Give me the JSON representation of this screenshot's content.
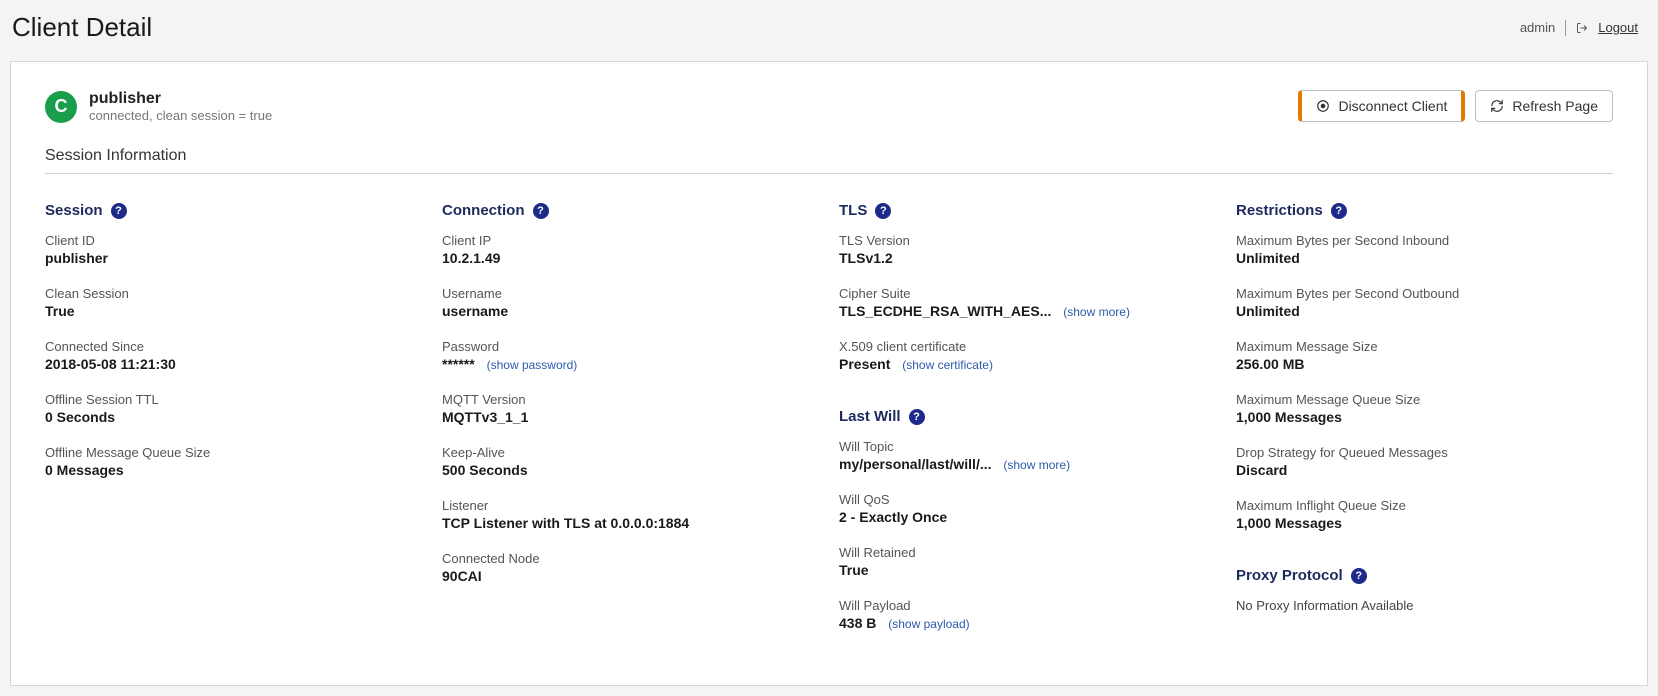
{
  "header": {
    "title": "Client Detail",
    "user": "admin",
    "logout": "Logout"
  },
  "client": {
    "avatar_letter": "C",
    "name": "publisher",
    "status_line": "connected, clean session = true"
  },
  "buttons": {
    "disconnect": "Disconnect Client",
    "refresh": "Refresh Page"
  },
  "section_title": "Session Information",
  "groups": {
    "session": {
      "title": "Session",
      "client_id": {
        "label": "Client ID",
        "value": "publisher"
      },
      "clean_session": {
        "label": "Clean Session",
        "value": "True"
      },
      "connected_since": {
        "label": "Connected Since",
        "value": "2018-05-08 11:21:30"
      },
      "offline_ttl": {
        "label": "Offline Session TTL",
        "value": "0 Seconds"
      },
      "offline_queue": {
        "label": "Offline Message Queue Size",
        "value": "0 Messages"
      }
    },
    "connection": {
      "title": "Connection",
      "client_ip": {
        "label": "Client IP",
        "value": "10.2.1.49"
      },
      "username": {
        "label": "Username",
        "value": "username"
      },
      "password": {
        "label": "Password",
        "value": "******",
        "link": "(show password)"
      },
      "mqtt_version": {
        "label": "MQTT Version",
        "value": "MQTTv3_1_1"
      },
      "keep_alive": {
        "label": "Keep-Alive",
        "value": "500 Seconds"
      },
      "listener": {
        "label": "Listener",
        "value": "TCP Listener with TLS at 0.0.0.0:1884"
      },
      "connected_node": {
        "label": "Connected Node",
        "value": "90CAI"
      }
    },
    "tls": {
      "title": "TLS",
      "version": {
        "label": "TLS Version",
        "value": "TLSv1.2"
      },
      "cipher": {
        "label": "Cipher Suite",
        "value": "TLS_ECDHE_RSA_WITH_AES...",
        "link": "(show more)"
      },
      "cert": {
        "label": "X.509 client certificate",
        "value": "Present",
        "link": "(show certificate)"
      }
    },
    "last_will": {
      "title": "Last Will",
      "topic": {
        "label": "Will Topic",
        "value": "my/personal/last/will/...",
        "link": "(show more)"
      },
      "qos": {
        "label": "Will QoS",
        "value": "2 - Exactly Once"
      },
      "retained": {
        "label": "Will Retained",
        "value": "True"
      },
      "payload": {
        "label": "Will Payload",
        "value": "438 B",
        "link": "(show payload)"
      }
    },
    "restrictions": {
      "title": "Restrictions",
      "max_in": {
        "label": "Maximum Bytes per Second Inbound",
        "value": "Unlimited"
      },
      "max_out": {
        "label": "Maximum Bytes per Second Outbound",
        "value": "Unlimited"
      },
      "max_msg_size": {
        "label": "Maximum Message Size",
        "value": "256.00 MB"
      },
      "max_queue": {
        "label": "Maximum Message Queue Size",
        "value": "1,000 Messages"
      },
      "drop_strategy": {
        "label": "Drop Strategy for Queued Messages",
        "value": "Discard"
      },
      "max_inflight": {
        "label": "Maximum Inflight Queue Size",
        "value": "1,000 Messages"
      }
    },
    "proxy": {
      "title": "Proxy Protocol",
      "none_text": "No Proxy Information Available"
    }
  }
}
